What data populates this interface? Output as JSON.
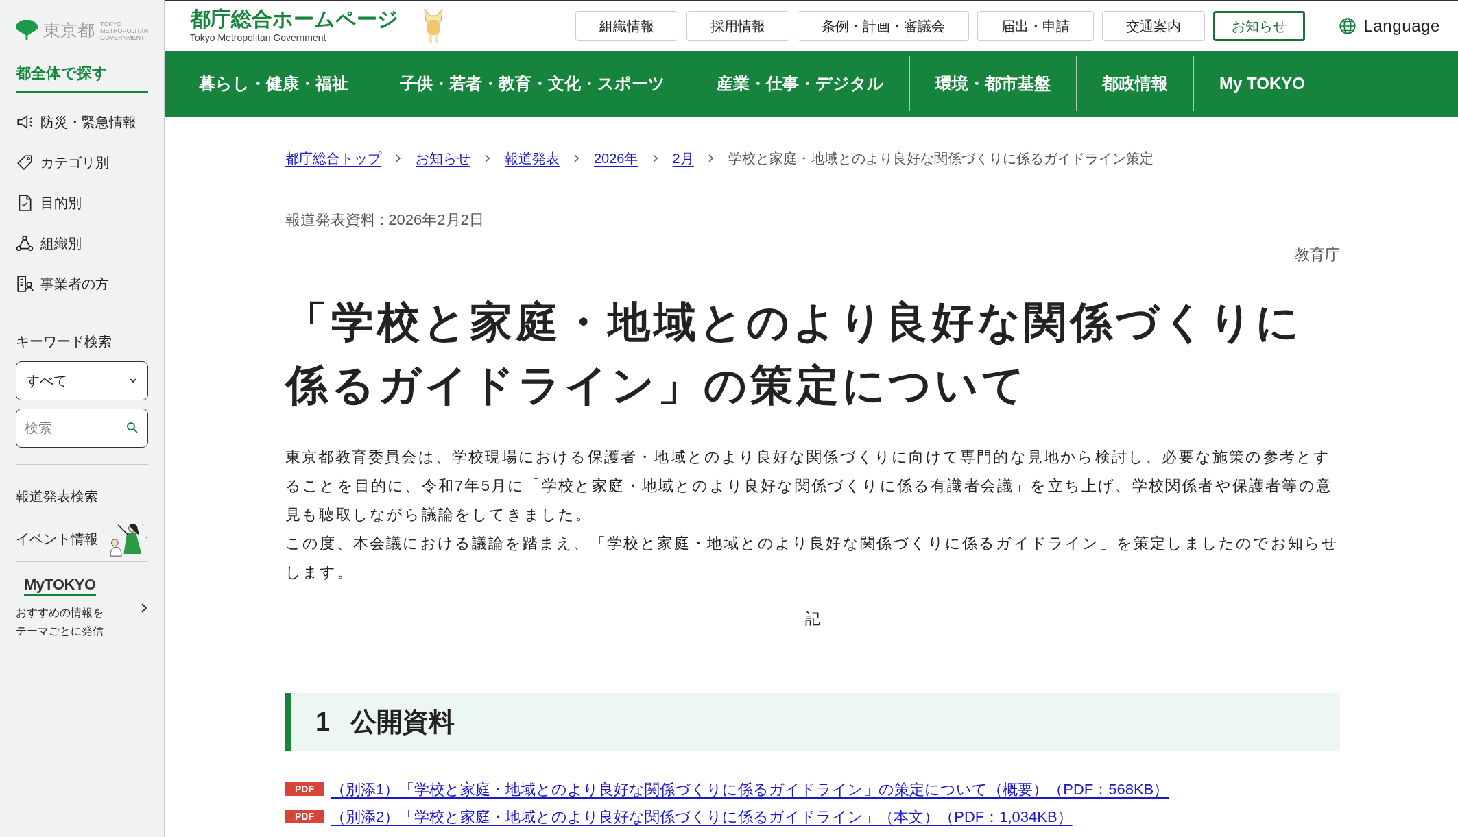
{
  "sidebar": {
    "logo": {
      "text": "東京都",
      "subtext": "TOKYO METROPOLITAN GOVERNMENT"
    },
    "heading": "都全体で探す",
    "items": [
      {
        "label": "防災・緊急情報",
        "kind": "megaphone"
      },
      {
        "label": "カテゴリ別",
        "kind": "tag"
      },
      {
        "label": "目的別",
        "kind": "document"
      },
      {
        "label": "組織別",
        "kind": "org"
      },
      {
        "label": "事業者の方",
        "kind": "business"
      }
    ],
    "keyword_label": "キーワード検索",
    "select_value": "すべて",
    "search": {
      "placeholder": "検索"
    },
    "links": [
      {
        "label": "報道発表検索"
      },
      {
        "label": "イベント情報"
      }
    ],
    "mytokyo": {
      "logo": "MyTOKYO",
      "lines": [
        "おすすめの情報を",
        "テーマごとに発信"
      ]
    }
  },
  "header": {
    "title": "都庁総合ホームページ",
    "subtitle": "Tokyo Metropolitan Government",
    "buttons": [
      {
        "label": "組織情報",
        "selected": false
      },
      {
        "label": "採用情報",
        "selected": false
      },
      {
        "label": "条例・計画・審議会",
        "selected": false
      },
      {
        "label": "届出・申請",
        "selected": false
      },
      {
        "label": "交通案内",
        "selected": false
      },
      {
        "label": "お知らせ",
        "selected": true
      }
    ],
    "language": "Language"
  },
  "nav": [
    "暮らし・健康・福祉",
    "子供・若者・教育・文化・スポーツ",
    "産業・仕事・デジタル",
    "環境・都市基盤",
    "都政情報",
    "My TOKYO"
  ],
  "breadcrumb": {
    "links": [
      "都庁総合トップ",
      "お知らせ",
      "報道発表",
      "2026年",
      "2月"
    ],
    "current": "学校と家庭・地域とのより良好な関係づくりに係るガイドライン策定"
  },
  "date": "報道発表資料 : 2026年2月2日",
  "department": "教育庁",
  "title": "「学校と家庭・地域とのより良好な関係づくりに係るガイドライン」の策定について",
  "paragraphs": [
    "東京都教育委員会は、学校現場における保護者・地域とのより良好な関係づくりに向けて専門的な見地から検討し、必要な施策の参考とすることを目的に、令和7年5月に「学校と家庭・地域とのより良好な関係づくりに係る有識者会議」を立ち上げ、学校関係者や保護者等の意見も聴取しながら議論をしてきました。",
    "この度、本会議における議論を踏まえ、「学校と家庭・地域とのより良好な関係づくりに係るガイドライン」を策定しましたのでお知らせします。"
  ],
  "ki": "記",
  "section": {
    "number": "1",
    "title": "公開資料"
  },
  "files": [
    {
      "badge": "PDF",
      "label": "（別添1）「学校と家庭・地域とのより良好な関係づくりに係るガイドライン」の策定について（概要）（PDF：568KB）"
    },
    {
      "badge": "PDF",
      "label": "（別添2）「学校と家庭・地域とのより良好な関係づくりに係るガイドライン」（本文）（PDF：1,034KB）"
    }
  ]
}
